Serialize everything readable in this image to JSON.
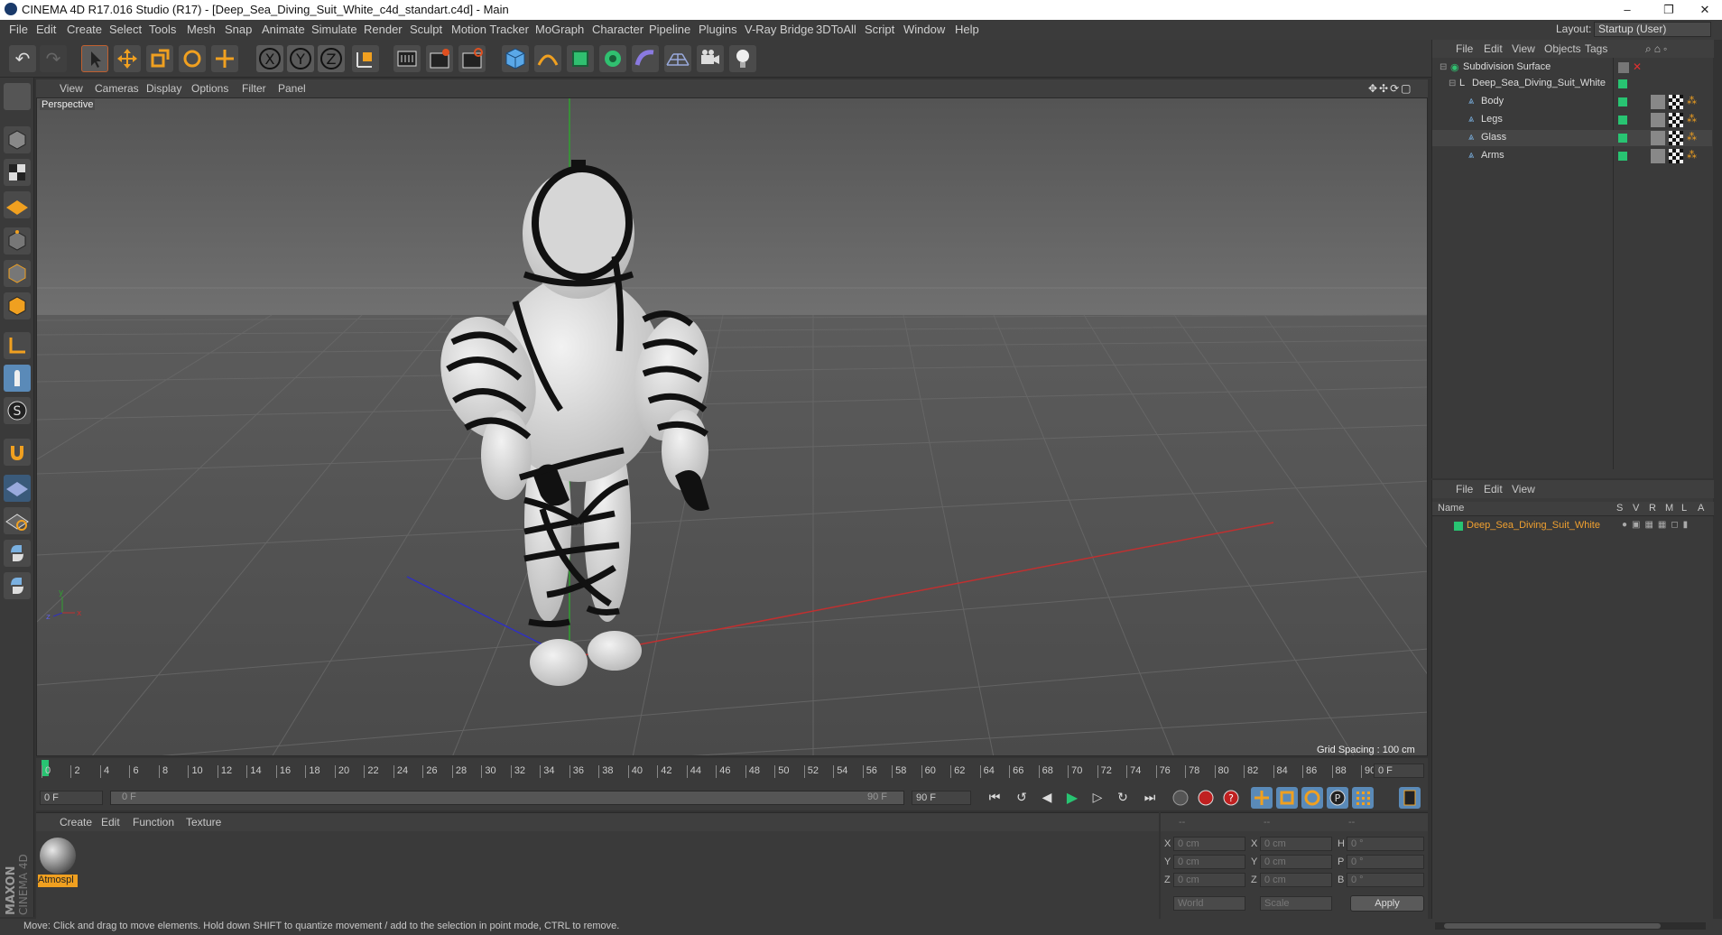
{
  "window": {
    "title": "CINEMA 4D R17.016 Studio (R17) - [Deep_Sea_Diving_Suit_White_c4d_standart.c4d] - Main",
    "minimize": "–",
    "restore": "❐",
    "close": "✕"
  },
  "menu": [
    "File",
    "Edit",
    "Create",
    "Select",
    "Tools",
    "Mesh",
    "Snap",
    "Animate",
    "Simulate",
    "Render",
    "Sculpt",
    "Motion Tracker",
    "MoGraph",
    "Character",
    "Pipeline",
    "Plugins",
    "V-Ray Bridge",
    "3DToAll",
    "Script",
    "Window",
    "Help"
  ],
  "layout": {
    "label": "Layout:",
    "value": "Startup (User)"
  },
  "viewport": {
    "menu": [
      "View",
      "Cameras",
      "Display",
      "Options",
      "Filter",
      "Panel"
    ],
    "camera": "Perspective",
    "grid_spacing": "Grid Spacing : 100 cm"
  },
  "timeline": {
    "ticks": [
      "0",
      "2",
      "4",
      "6",
      "8",
      "10",
      "12",
      "14",
      "16",
      "18",
      "20",
      "22",
      "24",
      "26",
      "28",
      "30",
      "32",
      "34",
      "36",
      "38",
      "40",
      "42",
      "44",
      "46",
      "48",
      "50",
      "52",
      "54",
      "56",
      "58",
      "60",
      "62",
      "64",
      "66",
      "68",
      "70",
      "72",
      "74",
      "76",
      "78",
      "80",
      "82",
      "84",
      "86",
      "88",
      "90"
    ],
    "current_frame": "0 F",
    "start_field": "0 F",
    "range_start": "0 F",
    "range_end": "90 F",
    "end_field": "90 F"
  },
  "material_panel": {
    "menu": [
      "Create",
      "Edit",
      "Function",
      "Texture"
    ],
    "material_name": "Atmospl"
  },
  "coord_panel": {
    "headers": [
      "--",
      "--",
      "--"
    ],
    "rows": [
      {
        "a": "X",
        "av": "0 cm",
        "b": "X",
        "bv": "0 cm",
        "c": "H",
        "cv": "0 °"
      },
      {
        "a": "Y",
        "av": "0 cm",
        "b": "Y",
        "bv": "0 cm",
        "c": "P",
        "cv": "0 °"
      },
      {
        "a": "Z",
        "av": "0 cm",
        "b": "Z",
        "bv": "0 cm",
        "c": "B",
        "cv": "0 °"
      }
    ],
    "world": "World",
    "scale": "Scale",
    "apply": "Apply"
  },
  "object_manager": {
    "menu": [
      "File",
      "Edit",
      "View",
      "Objects",
      "Tags"
    ],
    "objects": [
      {
        "name": "Subdivision Surface",
        "level": 0
      },
      {
        "name": "Deep_Sea_Diving_Suit_White",
        "level": 1
      },
      {
        "name": "Body",
        "level": 2
      },
      {
        "name": "Legs",
        "level": 2
      },
      {
        "name": "Glass",
        "level": 2
      },
      {
        "name": "Arms",
        "level": 2
      }
    ]
  },
  "attribute_manager": {
    "menu": [
      "File",
      "Edit",
      "View"
    ],
    "columns": [
      "Name",
      "S",
      "V",
      "R",
      "M",
      "L",
      "A"
    ],
    "item": "Deep_Sea_Diving_Suit_White"
  },
  "side_logo": {
    "line1": "MAXON",
    "line2": "CINEMA 4D"
  },
  "status": "Move: Click and drag to move elements. Hold down SHIFT to quantize movement / add to the selection in point mode, CTRL to remove.",
  "colors": {
    "accent": "#28c472",
    "selected_name": "#f0a030",
    "axis_x": "#c03030",
    "axis_y": "#30a030",
    "axis_z": "#3030c0"
  }
}
